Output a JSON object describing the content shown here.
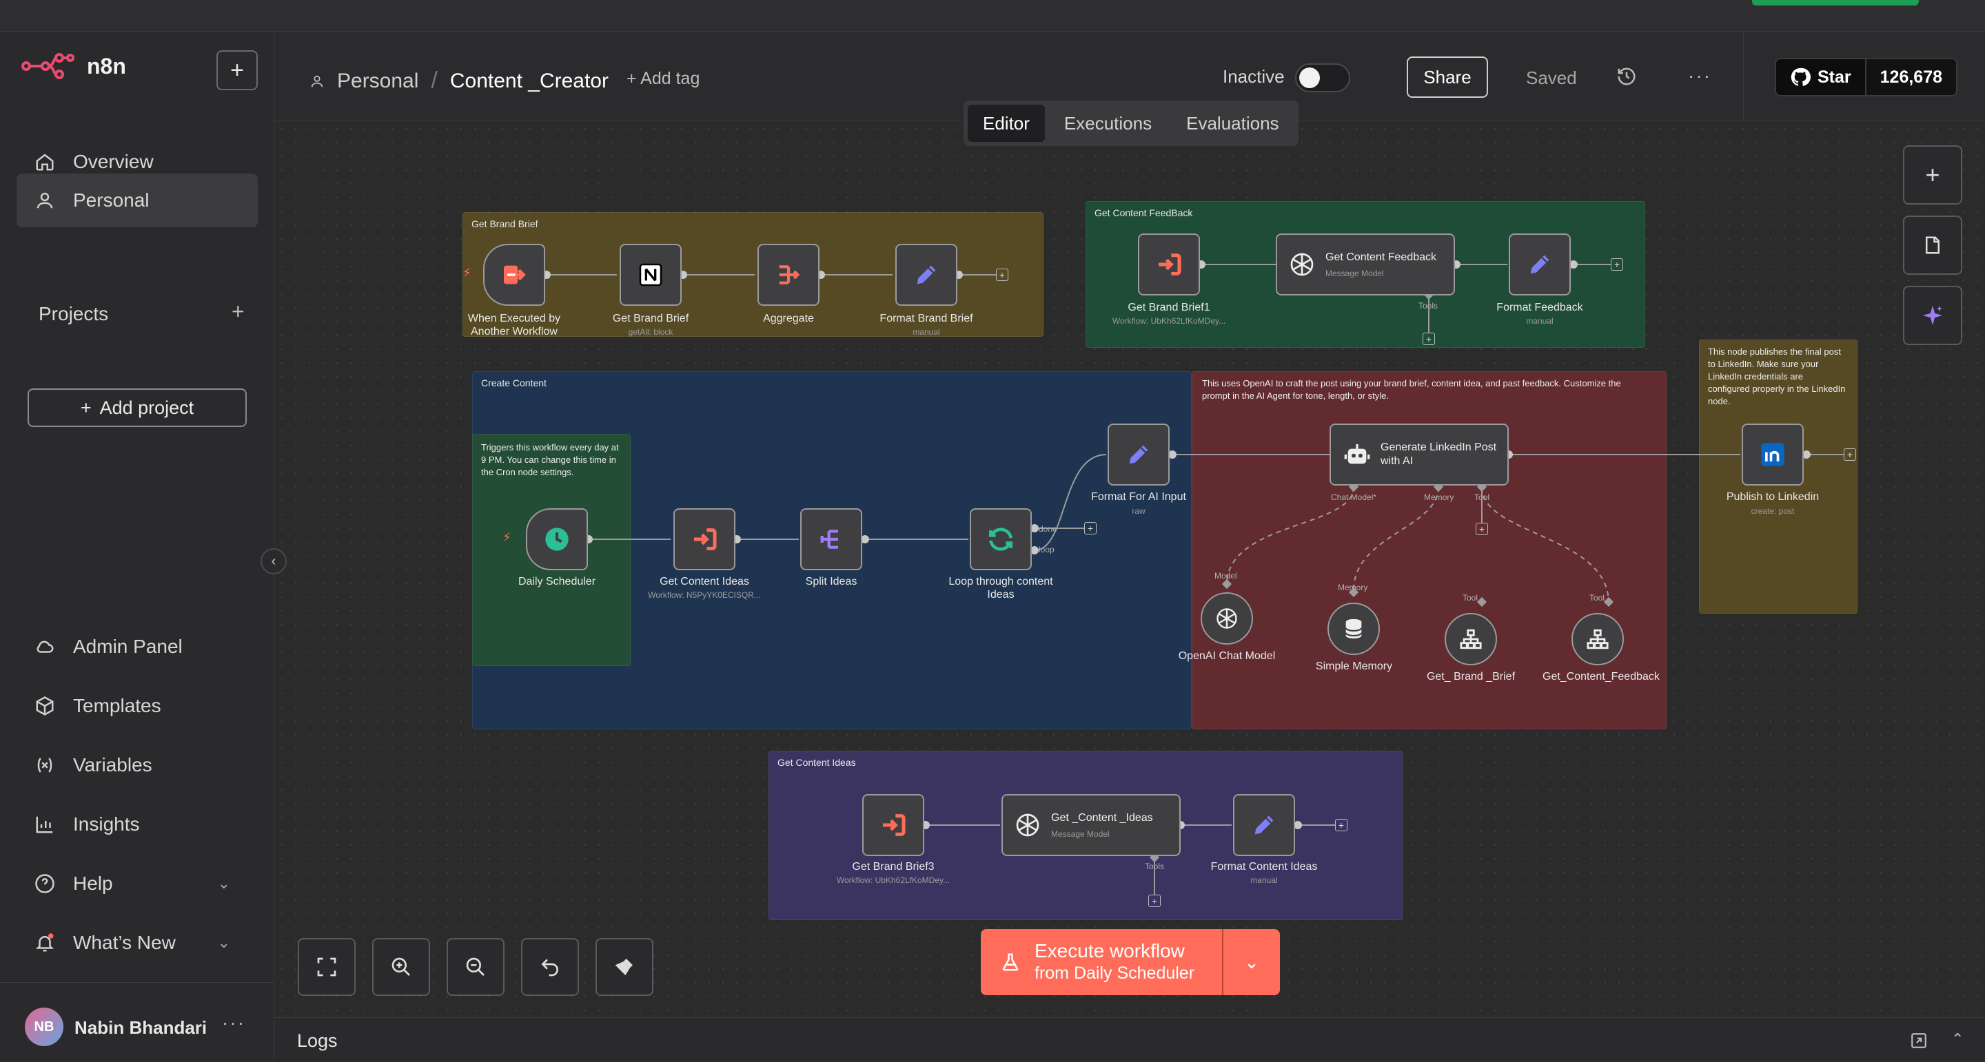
{
  "app": {
    "name": "n8n"
  },
  "sidebar": {
    "items": [
      {
        "label": "Overview",
        "icon": "home-icon"
      },
      {
        "label": "Personal",
        "icon": "user-icon"
      }
    ],
    "projects_label": "Projects",
    "add_project_label": "Add project",
    "bottom_items": [
      {
        "label": "Admin Panel",
        "icon": "cloud-icon"
      },
      {
        "label": "Templates",
        "icon": "box-icon"
      },
      {
        "label": "Variables",
        "icon": "variable-icon"
      },
      {
        "label": "Insights",
        "icon": "chart-icon"
      },
      {
        "label": "Help",
        "icon": "help-icon"
      },
      {
        "label": "What’s New",
        "icon": "bell-icon"
      }
    ],
    "user": {
      "initials": "NB",
      "name": "Nabin Bhandari"
    }
  },
  "header": {
    "breadcrumb_project": "Personal",
    "breadcrumb_sep": "/",
    "workflow_name": "Content _Creator",
    "add_tag": "+ Add tag",
    "status": "Inactive",
    "share": "Share",
    "saved": "Saved",
    "github_star": "Star",
    "github_count": "126,678"
  },
  "tabs": [
    "Editor",
    "Executions",
    "Evaluations"
  ],
  "canvas": {
    "groups": {
      "brand_brief": "Get Brand Brief",
      "content_feedback": "Get Content FeedBack",
      "create_content": "Create Content",
      "ai_note": "This uses OpenAI to craft the post using your brand brief, content idea, and past feedback. Customize the prompt in the AI Agent for tone, length, or style.",
      "publish_note": "This node publishes the final post to LinkedIn. Make sure your LinkedIn credentials are configured properly in the LinkedIn node.",
      "trigger_note": "Triggers this workflow every day at 9 PM. You can change this time in the Cron node settings.",
      "content_ideas": "Get Content Ideas"
    },
    "nodes": {
      "when_executed": {
        "label": "When Executed by Another Workflow"
      },
      "get_brand_brief": {
        "label": "Get Brand Brief",
        "sub": "getAll: block"
      },
      "aggregate": {
        "label": "Aggregate"
      },
      "format_brand_brief": {
        "label": "Format Brand Brief",
        "sub": "manual"
      },
      "get_brand_brief1": {
        "label": "Get Brand Brief1",
        "sub": "Workflow: UbKh62LfKoMDey..."
      },
      "get_content_feedback": {
        "label": "Get Content Feedback",
        "sub": "Message Model"
      },
      "format_feedback": {
        "label": "Format Feedback",
        "sub": "manual"
      },
      "daily_scheduler": {
        "label": "Daily Scheduler"
      },
      "get_content_ideas": {
        "label": "Get Content Ideas",
        "sub": "Workflow: N5PyYK0ECISQR..."
      },
      "split_ideas": {
        "label": "Split Ideas"
      },
      "loop": {
        "label": "Loop through content Ideas"
      },
      "format_ai_input": {
        "label": "Format For AI Input",
        "sub": "raw"
      },
      "generate_post": {
        "label": "Generate LinkedIn Post with AI"
      },
      "openai_chat": {
        "label": "OpenAI Chat Model"
      },
      "simple_memory": {
        "label": "Simple Memory"
      },
      "tool_brand_brief": {
        "label": "Get_ Brand _Brief"
      },
      "tool_content_feedback": {
        "label": "Get_Content_Feedback"
      },
      "publish_linkedin": {
        "label": "Publish to Linkedin",
        "sub": "create: post"
      },
      "get_brand_brief3": {
        "label": "Get Brand Brief3",
        "sub": "Workflow: UbKh62LfKoMDey..."
      },
      "get_content_ideas2": {
        "label": "Get _Content _Ideas",
        "sub": "Message Model"
      },
      "format_content_ideas": {
        "label": "Format Content Ideas",
        "sub": "manual"
      }
    },
    "ports": {
      "tools": "Tools",
      "done": "done",
      "loop": "loop",
      "chat_model": "Chat Model*",
      "memory": "Memory",
      "tool": "Tool",
      "model": "Model"
    }
  },
  "execute": {
    "line1": "Execute workflow",
    "line2": "from Daily Scheduler"
  },
  "logs": {
    "label": "Logs"
  },
  "colors": {
    "accent": "#ff6d5a",
    "brand_group": "#554a24",
    "feedback_group": "#1f4c36",
    "create_group": "#1e3450",
    "ai_group": "#622b2f",
    "ideas_group": "#3b3460"
  }
}
